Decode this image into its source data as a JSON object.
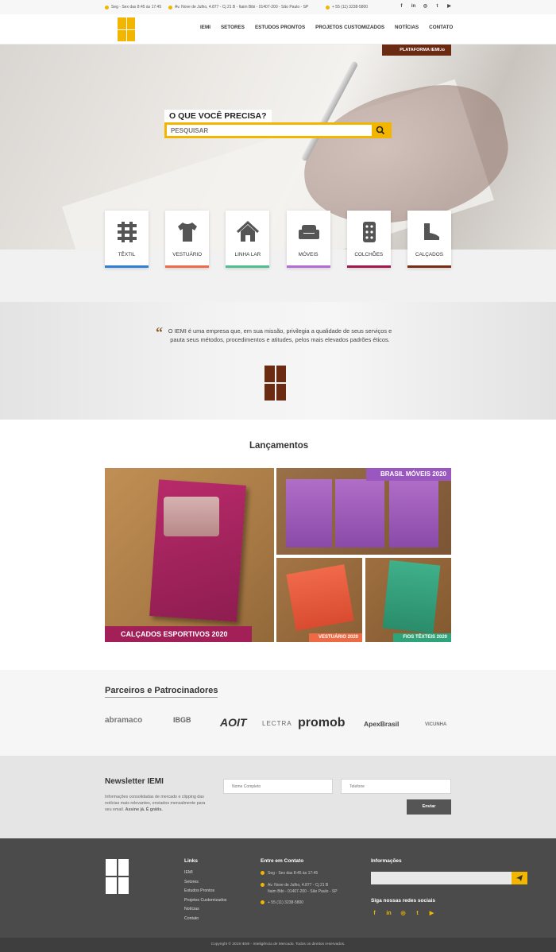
{
  "topbar": {
    "hours": "Seg - Sex das 8:45 às 17:45",
    "address": "Av. Nove de Julho, 4.877 - Cj 21 B - Itaim Bibi - 01407-200 - São Paulo - SP",
    "phone": "+ 55 (11) 3238-5800",
    "socials": [
      "facebook-icon",
      "linkedin-icon",
      "instagram-icon",
      "twitter-icon",
      "youtube-icon"
    ]
  },
  "nav": [
    "IEMI",
    "SETORES",
    "ESTUDOS PRONTOS",
    "PROJETOS CUSTOMIZADOS",
    "NOTÍCIAS",
    "CONTATO"
  ],
  "hero": {
    "platform": "PLATAFORMA IEMI.io",
    "title": "O QUE VOCÊ PRECISA?",
    "placeholder": "PESQUISAR"
  },
  "sectors": [
    {
      "label": "TÊXTIL",
      "color": "#2f7fd6"
    },
    {
      "label": "VESTUÁRIO",
      "color": "#f06a4a"
    },
    {
      "label": "LINHA LAR",
      "color": "#4cc08e"
    },
    {
      "label": "MÓVEIS",
      "color": "#b56ad6"
    },
    {
      "label": "COLCHÕES",
      "color": "#a3174f"
    },
    {
      "label": "CALÇADOS",
      "color": "#7a2c12"
    }
  ],
  "quote": "O IEMI é uma empresa que, em sua missão, privilegia a qualidade de seus serviços e pauta seus métodos, procedimentos e atitudes, pelos mais elevados padrões éticos.",
  "launches": {
    "title": "Lançamentos",
    "main": "CALÇADOS ESPORTIVOS 2020",
    "moveis": "BRASIL MÓVEIS 2020",
    "vestuario": "VESTUÁRIO 2020",
    "fios": "FIOS TÊXTEIS 2020"
  },
  "partners": {
    "title": "Parceiros e Patrocinadores",
    "logos": [
      "abramaco",
      "IBGB",
      "AOIT",
      "LECTRA",
      "promob",
      "ApexBrasil",
      "VICUNHA"
    ]
  },
  "newsletter": {
    "title": "Newsletter IEMI",
    "desc": "Informações consolidadas de mercado e clipping das notícias mais relevantes, enviados mensalmente para seu email.",
    "cta": "Assine já. É grátis.",
    "name_placeholder": "Nome Completo",
    "phone_placeholder": "Telefone",
    "send": "Enviar"
  },
  "footer": {
    "links_title": "Links",
    "links": [
      "IEMI",
      "Setores",
      "Estudos Prontos",
      "Projetos Customizados",
      "Notícias",
      "Contato"
    ],
    "contact_title": "Entre em Contato",
    "hours": "Seg - Sex das 8:45 às 17:45",
    "address1": "Av. Nove de Julho, 4.877 - Cj 21 B",
    "address2": "Itaim Bibi - 01407-200 - São Paulo - SP",
    "phone": "+ 55 (11) 3238-5800",
    "info_title": "Informações",
    "social_title": "Siga nossas redes sociais",
    "copyright": "Copyright © 2019 IEMI - Inteligência de Mercado. Todos os direitos reservados."
  }
}
